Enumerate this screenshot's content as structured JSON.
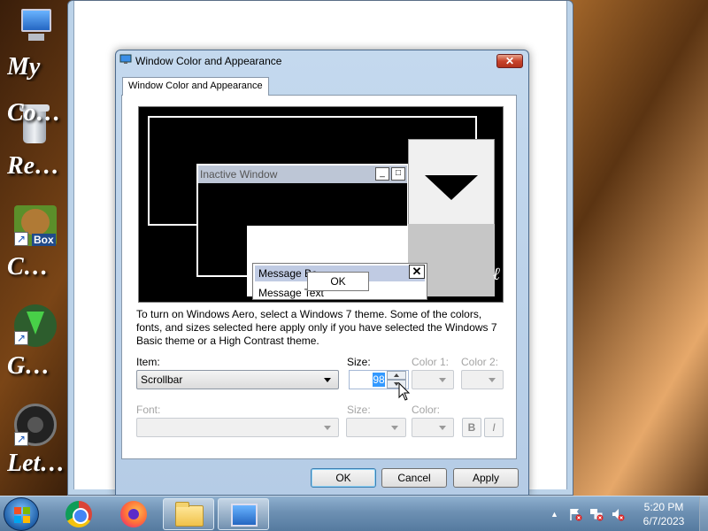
{
  "desktop": {
    "icons": [
      {
        "label": "My Co..."
      },
      {
        "label": "Re..."
      },
      {
        "label": "C..."
      },
      {
        "label": "G..."
      },
      {
        "label": "Let..."
      }
    ],
    "labels_raw": [
      "My",
      "Co…",
      "Re…",
      "C…",
      "G…",
      "Let…"
    ],
    "box_badge": "Box"
  },
  "dialog": {
    "title": "Window Color and Appearance",
    "tab": "Window Color and Appearance",
    "close": "✕",
    "preview": {
      "inactive_title": "Inactive Window",
      "message_title": "Message Bo",
      "message_text": "Message Text",
      "ok": "OK"
    },
    "description": "To turn on Windows Aero, select a Windows 7 theme.  Some of the colors, fonts, and sizes selected here apply only if you have selected the Windows 7 Basic theme or a High Contrast theme.",
    "item_label": "Item:",
    "item_value": "Scrollbar",
    "size_label": "Size:",
    "size_value": "98",
    "color1_label": "Color 1:",
    "color2_label": "Color 2:",
    "font_label": "Font:",
    "font_size_label": "Size:",
    "font_color_label": "Color:",
    "bold": "B",
    "italic": "I",
    "buttons": {
      "ok": "OK",
      "cancel": "Cancel",
      "apply": "Apply"
    }
  },
  "taskbar": {
    "time": "5:20 PM",
    "date": "6/7/2023",
    "tray_arrow": "▲"
  }
}
